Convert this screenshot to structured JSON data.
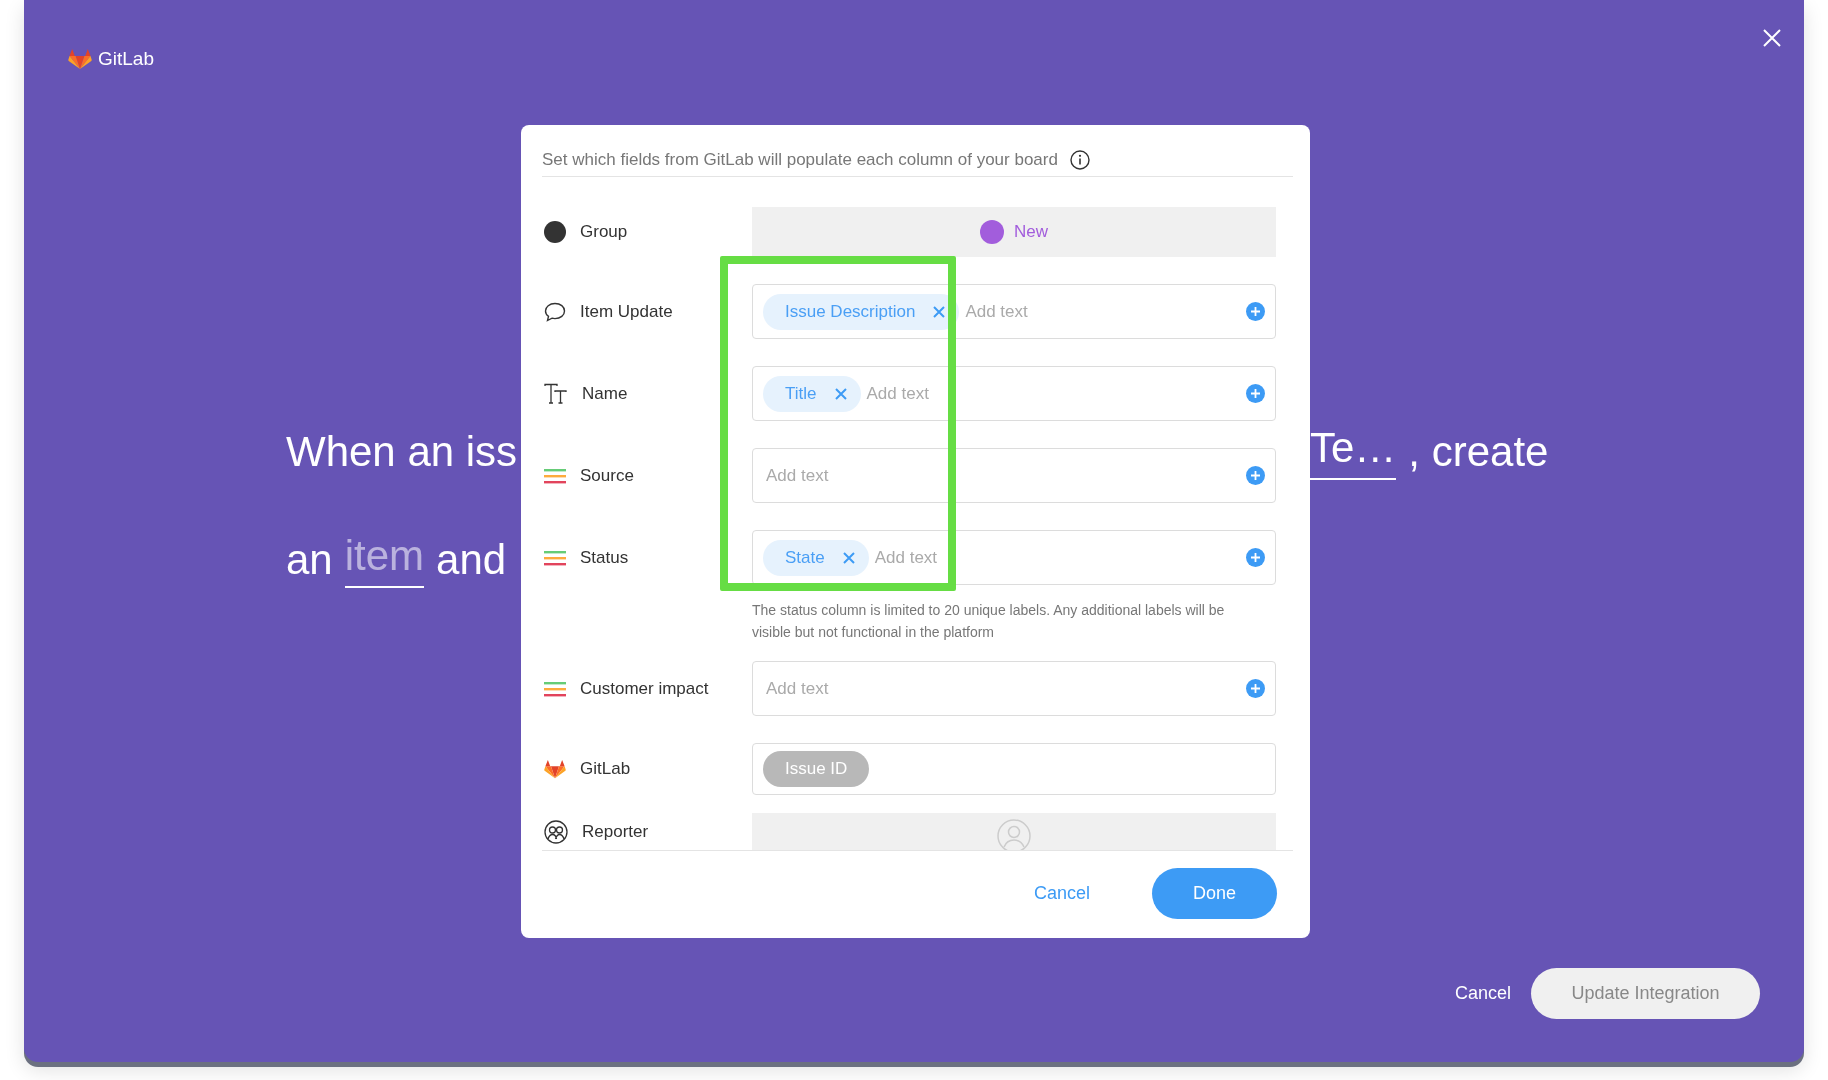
{
  "app": {
    "logo": "GitLab"
  },
  "background_sentence": {
    "line_1_start": "When an iss",
    "line_1_link": "Te…",
    "line_1_end": ", create",
    "line_2_start": "an",
    "line_2_link": "item",
    "line_2_end": "and"
  },
  "dialog": {
    "instructions": "Set which fields from GitLab will populate each column of your board",
    "rows": [
      {
        "kind": "group",
        "label": "Group",
        "value": "New",
        "color": "#a25ddc"
      },
      {
        "kind": "update",
        "label": "Item Update",
        "chips": [
          {
            "label": "Issue Description",
            "disabled": false
          }
        ],
        "placeholder": "Add text"
      },
      {
        "kind": "name",
        "label": "Name",
        "chips": [
          {
            "label": "Title",
            "disabled": false
          }
        ],
        "placeholder": "Add text"
      },
      {
        "kind": "status",
        "label": "Source",
        "placeholder": "Add text"
      },
      {
        "kind": "status",
        "label": "Status",
        "chips": [
          {
            "label": "State",
            "disabled": false
          }
        ],
        "placeholder": "Add text",
        "note": "The status column is limited to 20 unique labels. Any additional labels will be visible but not functional in the platform"
      },
      {
        "kind": "status",
        "label": "Customer impact",
        "placeholder": "Add text"
      },
      {
        "kind": "gitlab",
        "label": "GitLab",
        "chips": [
          {
            "label": "Issue ID",
            "disabled": true
          }
        ]
      },
      {
        "kind": "people",
        "label": "Reporter"
      }
    ],
    "cancel": "Cancel",
    "done": "Done"
  },
  "footer": {
    "cancel": "Cancel",
    "update": "Update Integration"
  }
}
